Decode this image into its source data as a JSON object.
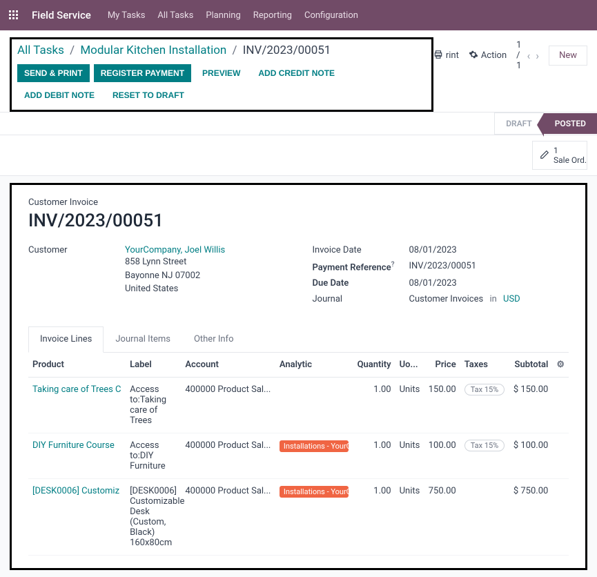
{
  "topbar": {
    "app_title": "Field Service",
    "nav": [
      "My Tasks",
      "All Tasks",
      "Planning",
      "Reporting",
      "Configuration"
    ]
  },
  "breadcrumb": {
    "root": "All Tasks",
    "mid": "Modular Kitchen Installation",
    "current": "INV/2023/00051"
  },
  "buttons": {
    "send_print": "SEND & PRINT",
    "register_payment": "REGISTER PAYMENT",
    "preview": "PREVIEW",
    "add_credit": "ADD CREDIT NOTE",
    "add_debit": "ADD DEBIT NOTE",
    "reset_draft": "RESET TO DRAFT"
  },
  "right": {
    "print_partial": "rint",
    "action": "Action",
    "pager": "1 / 1",
    "new": "New"
  },
  "status": {
    "draft": "DRAFT",
    "posted": "POSTED"
  },
  "sale_ord": {
    "count": "1",
    "label": "Sale Ord..."
  },
  "invoice": {
    "heading_small": "Customer Invoice",
    "number": "INV/2023/00051",
    "customer_label": "Customer",
    "customer_name": "YourCompany, Joel Willis",
    "addr1": "858 Lynn Street",
    "addr2": "Bayonne NJ 07002",
    "addr3": "United States",
    "invoice_date_label": "Invoice Date",
    "invoice_date": "08/01/2023",
    "payment_ref_label": "Payment Reference",
    "payment_ref": "INV/2023/00051",
    "due_date_label": "Due Date",
    "due_date": "08/01/2023",
    "journal_label": "Journal",
    "journal": "Customer Invoices",
    "journal_in": "in",
    "currency": "USD"
  },
  "tabs": [
    "Invoice Lines",
    "Journal Items",
    "Other Info"
  ],
  "columns": {
    "product": "Product",
    "label": "Label",
    "account": "Account",
    "analytic": "Analytic",
    "quantity": "Quantity",
    "uom": "Uo...",
    "price": "Price",
    "taxes": "Taxes",
    "subtotal": "Subtotal"
  },
  "lines": [
    {
      "product": "Taking care of Trees C",
      "label": "Access to:Taking care of Trees",
      "account": "400000 Product Sal...",
      "analytic": "",
      "quantity": "1.00",
      "uom": "Units",
      "price": "150.00",
      "taxes": "Tax 15%",
      "subtotal": "$ 150.00"
    },
    {
      "product": "DIY Furniture Course",
      "label": "Access to:DIY Furniture",
      "account": "400000 Product Sal...",
      "analytic": "Installations - YourCom",
      "quantity": "1.00",
      "uom": "Units",
      "price": "100.00",
      "taxes": "Tax 15%",
      "subtotal": "$ 100.00"
    },
    {
      "product": "[DESK0006] Customiz",
      "label": "[DESK0006] Customizable Desk (Custom, Black) 160x80cm",
      "account": "400000 Product Sal...",
      "analytic": "Installations - YourCom",
      "quantity": "1.00",
      "uom": "Units",
      "price": "750.00",
      "taxes": "",
      "subtotal": "$ 750.00"
    }
  ]
}
